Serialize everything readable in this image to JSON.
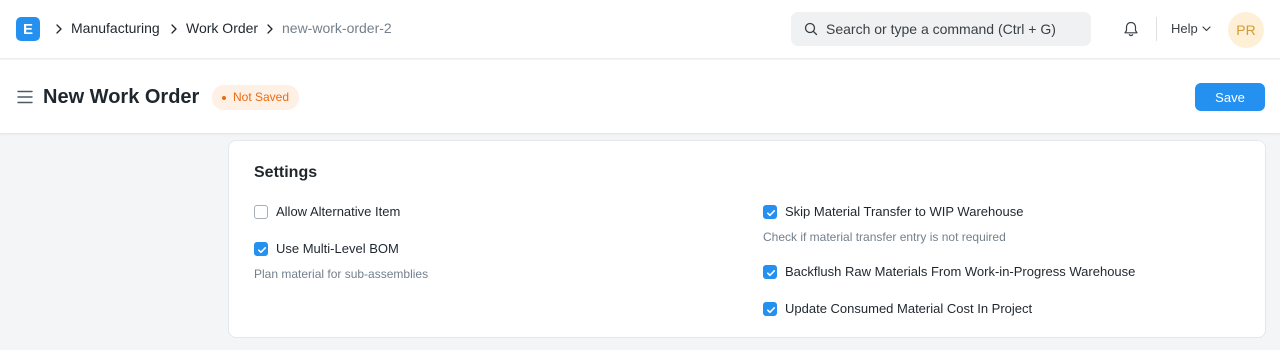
{
  "navbar": {
    "logo_letter": "E",
    "breadcrumbs": [
      "Manufacturing",
      "Work Order",
      "new-work-order-2"
    ],
    "search_placeholder": "Search or type a command (Ctrl + G)",
    "help_label": "Help",
    "avatar_initials": "PR",
    "icons": [
      "chevron-right-icon",
      "search-icon",
      "bell-icon",
      "chevron-down-icon"
    ]
  },
  "header": {
    "title": "New Work Order",
    "status": "Not Saved",
    "save_label": "Save"
  },
  "settings": {
    "title": "Settings",
    "left": [
      {
        "label": "Allow Alternative Item",
        "checked": false,
        "help": ""
      },
      {
        "label": "Use Multi-Level BOM",
        "checked": true,
        "help": "Plan material for sub-assemblies"
      }
    ],
    "right": [
      {
        "label": "Skip Material Transfer to WIP Warehouse",
        "checked": true,
        "help": "Check if material transfer entry is not required"
      },
      {
        "label": "Backflush Raw Materials From Work-in-Progress Warehouse",
        "checked": true,
        "help": ""
      },
      {
        "label": "Update Consumed Material Cost In Project",
        "checked": true,
        "help": ""
      }
    ]
  },
  "colors": {
    "primary": "#2490ef",
    "status_orange": "#e86c13",
    "status_bg": "#fff0e6"
  }
}
